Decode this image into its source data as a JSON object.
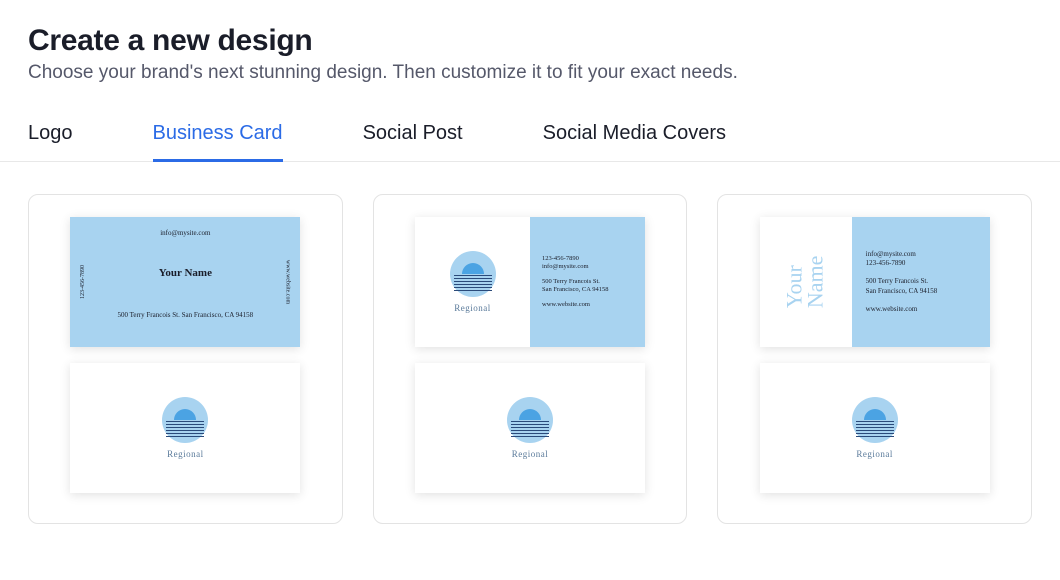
{
  "header": {
    "title": "Create a new design",
    "subtitle": "Choose your brand's next stunning design. Then customize it to fit your exact needs."
  },
  "tabs": [
    {
      "label": "Logo",
      "active": false
    },
    {
      "label": "Business Card",
      "active": true
    },
    {
      "label": "Social Post",
      "active": false
    },
    {
      "label": "Social Media Covers",
      "active": false
    }
  ],
  "brand": {
    "name": "Regional"
  },
  "cards": [
    {
      "front": {
        "email": "info@mysite.com",
        "name": "Your Name",
        "address": "500 Terry Francois St. San Francisco, CA 94158",
        "phone_side": "123-456-7890",
        "website_side": "www.website.com"
      }
    },
    {
      "front": {
        "phone": "123-456-7890",
        "email": "info@mysite.com",
        "address_line1": "500 Terry Francois St.",
        "address_line2": "San Francisco, CA 94158",
        "website": "www.website.com"
      }
    },
    {
      "front": {
        "name_line1": "Your",
        "name_line2": "Name",
        "email": "info@mysite.com",
        "phone": "123-456-7890",
        "address_line1": "500 Terry Francois St.",
        "address_line2": "San Francisco, CA 94158",
        "website": "www.website.com"
      }
    }
  ]
}
